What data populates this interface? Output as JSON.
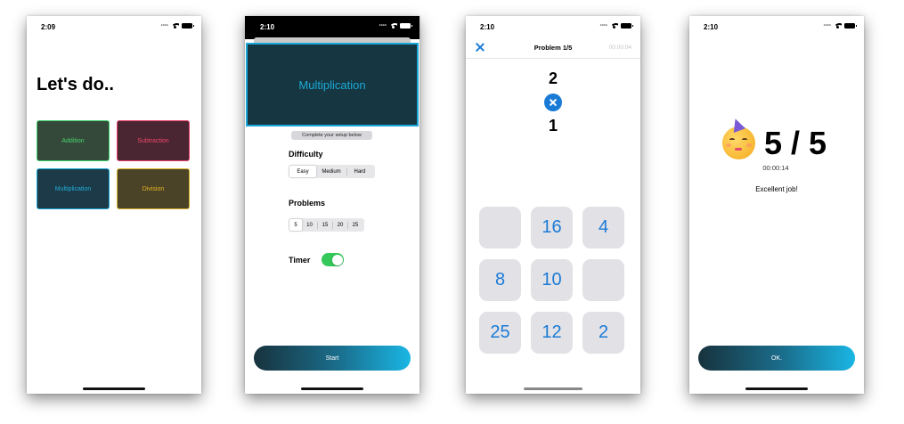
{
  "screen1": {
    "time": "2:09",
    "title": "Let's do..",
    "tiles": [
      {
        "label": "Addition"
      },
      {
        "label": "Subtraction"
      },
      {
        "label": "Multiplication"
      },
      {
        "label": "Division"
      }
    ]
  },
  "screen2": {
    "time": "2:10",
    "banner": "Multiplication",
    "setup_hint": "Complete your setup below",
    "difficulty_label": "Difficulty",
    "difficulty_options": [
      "Easy",
      "Medium",
      "Hard"
    ],
    "difficulty_selected": "Easy",
    "problems_label": "Problems",
    "problem_options": [
      "5",
      "10",
      "15",
      "20",
      "25"
    ],
    "problems_selected": "5",
    "timer_label": "Timer",
    "timer_on": true,
    "start_label": "Start"
  },
  "screen3": {
    "time": "2:10",
    "nav_title": "Problem 1/5",
    "timer": "00:00:04",
    "operand_top": "2",
    "operand_bottom": "1",
    "answers": [
      "",
      "16",
      "4",
      "8",
      "10",
      "",
      "25",
      "12",
      "2"
    ]
  },
  "screen4": {
    "time": "2:10",
    "score": "5 / 5",
    "elapsed": "00:00:14",
    "message": "Excellent job!",
    "ok_label": "OK."
  },
  "colors": {
    "addition": "#3bd16b",
    "subtraction": "#e8436a",
    "multiplication": "#1aa9d6",
    "division": "#d8b42a",
    "accent_blue": "#1a7bd6",
    "toggle_green": "#34c759"
  }
}
